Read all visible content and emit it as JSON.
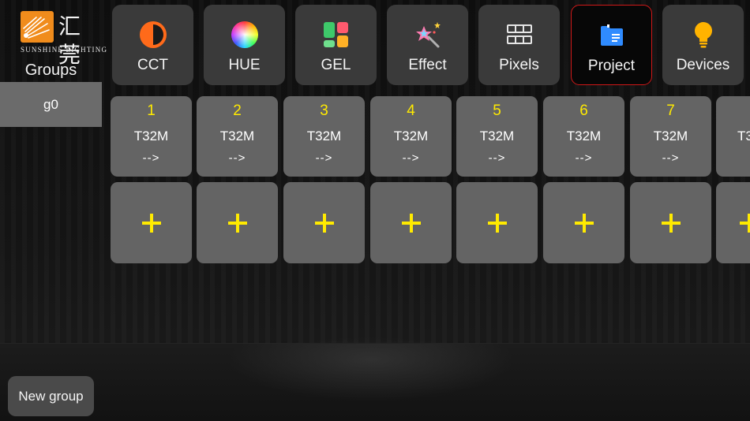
{
  "brand": {
    "name_cn": "汇莞",
    "name_en": "SUNSHINE LIGHTING",
    "accent": "#f08c1c"
  },
  "sidebar": {
    "title": "Groups",
    "groups": [
      {
        "label": "g0",
        "selected": true
      }
    ],
    "new_group_label": "New group"
  },
  "nav": {
    "active": "Project",
    "active_border_color": "#d01818",
    "items": [
      {
        "label": "CCT",
        "icon": "cct-half-circle-icon"
      },
      {
        "label": "HUE",
        "icon": "hue-color-wheel-icon"
      },
      {
        "label": "GEL",
        "icon": "gel-color-blocks-icon"
      },
      {
        "label": "Effect",
        "icon": "effect-magic-wand-icon"
      },
      {
        "label": "Pixels",
        "icon": "pixels-grid-icon"
      },
      {
        "label": "Project",
        "icon": "project-folder-icon"
      },
      {
        "label": "Devices",
        "icon": "devices-lightbulb-icon"
      }
    ]
  },
  "devices": {
    "number_color": "#ffea00",
    "items": [
      {
        "number": "1",
        "model": "T32M",
        "arrow": "-->"
      },
      {
        "number": "2",
        "model": "T32M",
        "arrow": "-->"
      },
      {
        "number": "3",
        "model": "T32M",
        "arrow": "-->"
      },
      {
        "number": "4",
        "model": "T32M",
        "arrow": "-->"
      },
      {
        "number": "5",
        "model": "T32M",
        "arrow": "-->"
      },
      {
        "number": "6",
        "model": "T32M",
        "arrow": "-->"
      },
      {
        "number": "7",
        "model": "T32M",
        "arrow": "-->"
      },
      {
        "number": "",
        "model": "T3",
        "arrow": ""
      }
    ]
  }
}
